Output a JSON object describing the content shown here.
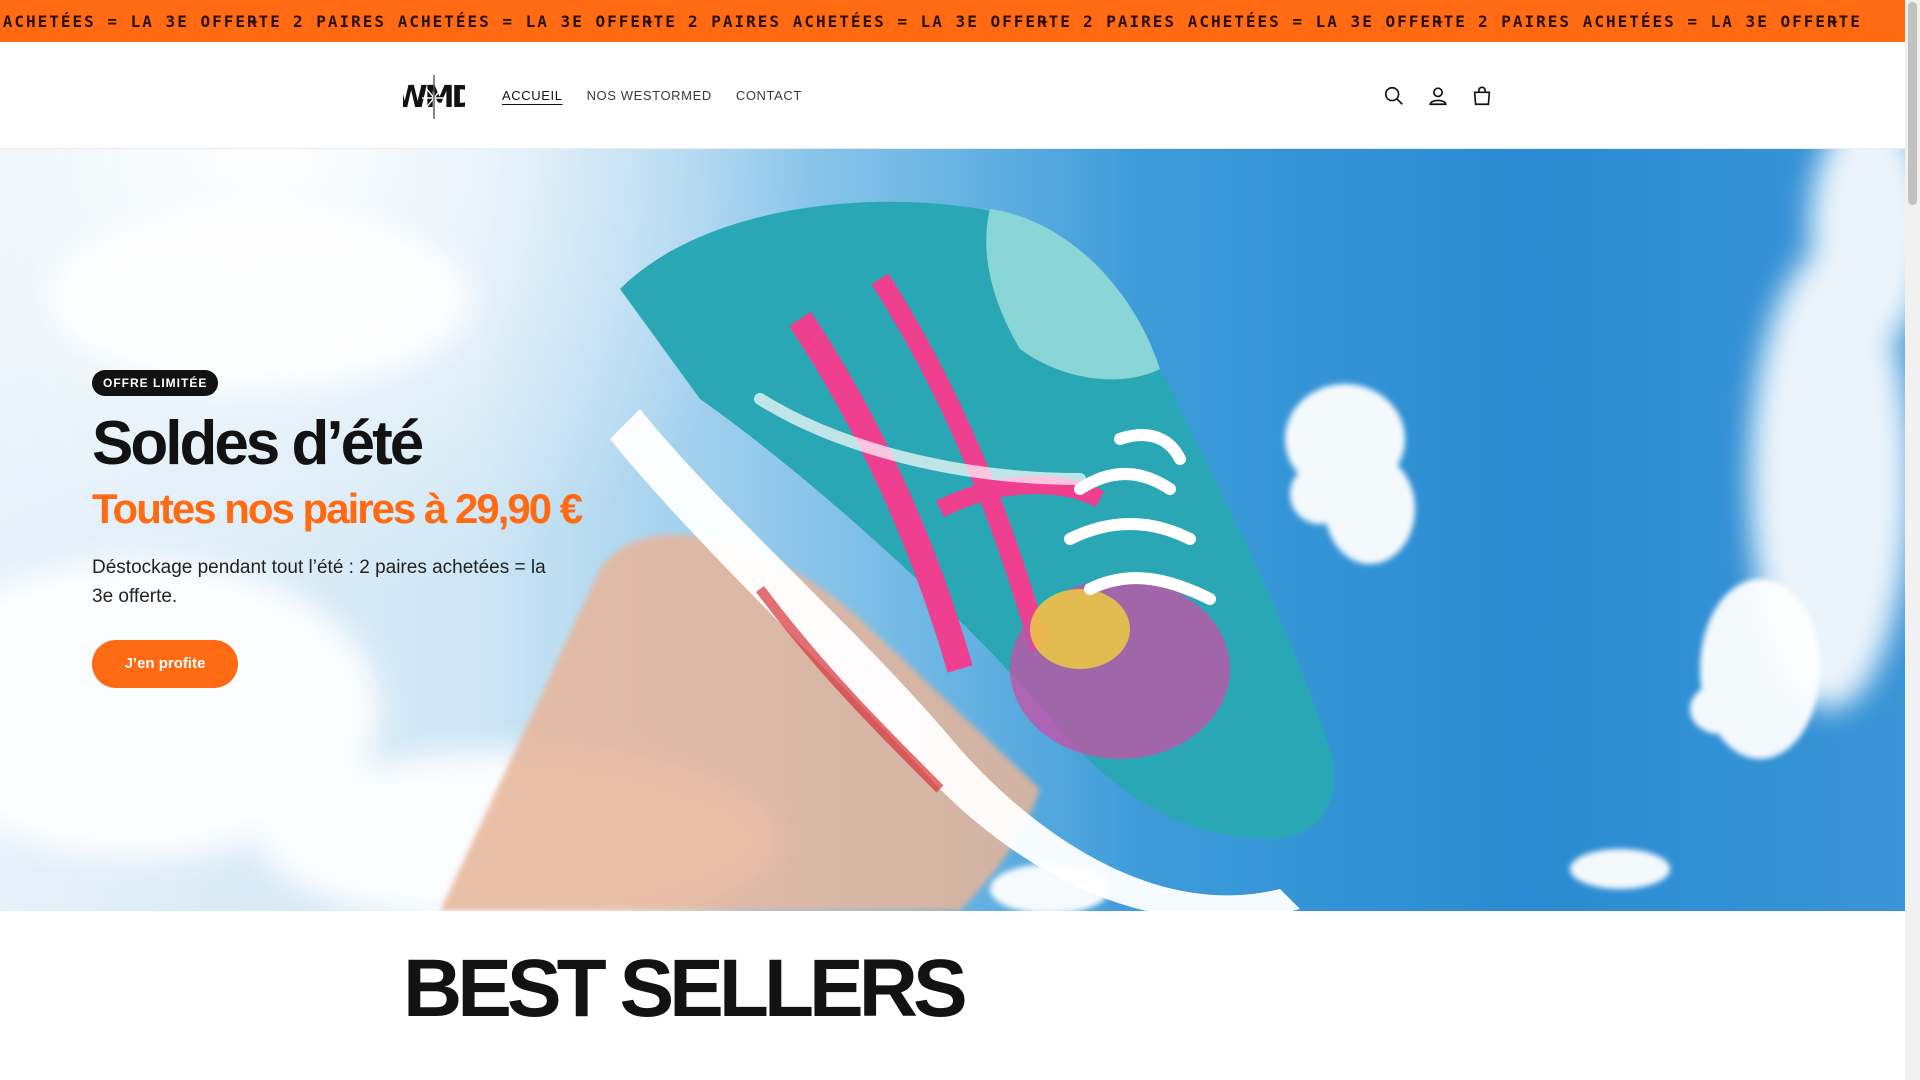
{
  "announcement": {
    "text": "2 PAIRES ACHETÉES = LA 3E OFFERTE",
    "separator": "✦",
    "bg_color": "#ff6a13"
  },
  "header": {
    "logo_text": "WMD",
    "nav": [
      {
        "label": "ACCUEIL",
        "active": true
      },
      {
        "label": "NOS WESTORMED",
        "active": false
      },
      {
        "label": "CONTACT",
        "active": false
      }
    ],
    "icons": [
      "search-icon",
      "account-icon",
      "cart-icon"
    ]
  },
  "hero": {
    "badge": "OFFRE LIMITÉE",
    "title": "Soldes d’été",
    "subtitle": "Toutes nos paires à 29,90 €",
    "description": "Déstockage pendant tout l’été : 2 paires achetées = la 3e offerte.",
    "cta_label": "J’en profite",
    "accent_color": "#ff6a13"
  },
  "best_sellers": {
    "title": "BEST SELLERS"
  }
}
